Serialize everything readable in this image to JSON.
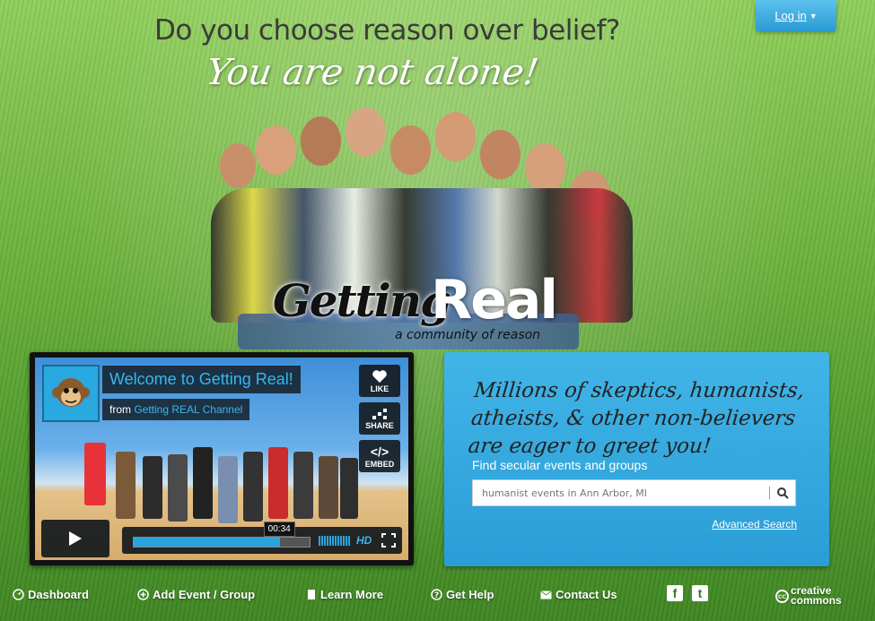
{
  "header": {
    "headline": "Do you choose reason over belief?",
    "subline": "You are not alone!",
    "login_label": "Log in"
  },
  "logo": {
    "word1": "Getting",
    "word2": "Real",
    "tagline": "a community of reason"
  },
  "video": {
    "title": "Welcome to Getting Real!",
    "from_label": "from",
    "channel": "Getting REAL Channel",
    "like_label": "LIKE",
    "share_label": "SHARE",
    "embed_label": "EMBED",
    "time": "00:34",
    "progress": 0.83,
    "hd_label": "HD"
  },
  "search_panel": {
    "heading": "Millions of skeptics, humanists, atheists, & other non-believers are eager to greet you!",
    "label": "Find secular events and groups",
    "placeholder": "humanist events in Ann Arbor, MI",
    "advanced_link": "Advanced Search"
  },
  "footer": {
    "items": [
      {
        "label": "Dashboard",
        "icon": "dashboard-icon"
      },
      {
        "label": "Add Event / Group",
        "icon": "plus-circle-icon"
      },
      {
        "label": "Learn More",
        "icon": "book-icon"
      },
      {
        "label": "Get Help",
        "icon": "question-icon"
      },
      {
        "label": "Contact Us",
        "icon": "envelope-icon"
      }
    ],
    "facebook": "f",
    "twitter": "t",
    "cc_line1": "creative",
    "cc_line2": "commons",
    "cc_badge": "cc"
  },
  "colors": {
    "accent": "#2a9dd6",
    "video_title": "#35b7f0",
    "grass": "#6db33c"
  }
}
